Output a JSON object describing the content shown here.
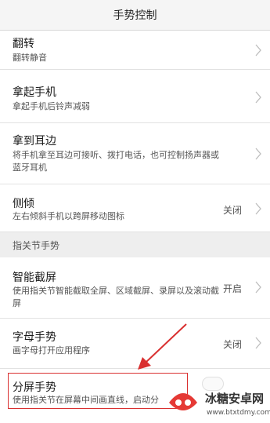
{
  "header": {
    "title": "手势控制"
  },
  "rows": [
    {
      "title": "翻转",
      "subtitle": "翻转静音",
      "status": ""
    },
    {
      "title": "拿起手机",
      "subtitle": "拿起手机后铃声减弱",
      "status": ""
    },
    {
      "title": "拿到耳边",
      "subtitle": "将手机拿至耳边可接听、拨打电话，也可控制扬声器或蓝牙耳机",
      "status": ""
    },
    {
      "title": "侧倾",
      "subtitle": "左右倾斜手机以跨屏移动图标",
      "status": "关闭"
    }
  ],
  "section": {
    "label": "指关节手势"
  },
  "rows2": [
    {
      "title": "智能截屏",
      "subtitle": "使用指关节智能截取全屏、区域截屏、录屏以及滚动截屏",
      "status": "开启"
    },
    {
      "title": "字母手势",
      "subtitle": "画字母打开应用程序",
      "status": "关闭"
    },
    {
      "title": "分屏手势",
      "subtitle": "使用指关节在屏幕中间画直线，启动分",
      "status": ""
    }
  ],
  "watermark": {
    "name": "冰糖安卓网",
    "url": "www.btxtdmy.com"
  },
  "colors": {
    "highlight": "#d93030",
    "arrow": "#d93030"
  }
}
